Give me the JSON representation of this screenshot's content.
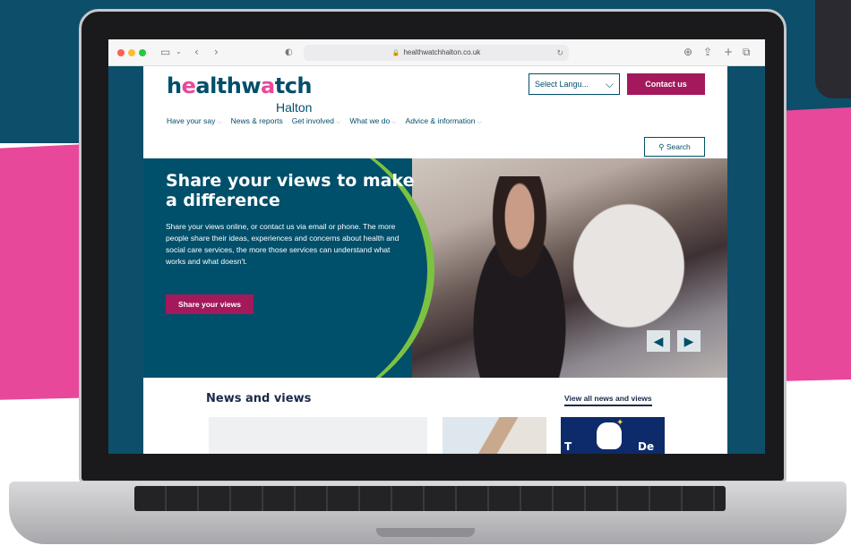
{
  "browser": {
    "url": "healthwatchhalton.co.uk"
  },
  "site": {
    "logo_main_1": "h",
    "logo_main_o": "e",
    "logo_main_2": "althw",
    "logo_main_o2": "a",
    "logo_main_3": "tch",
    "logo_sub": "Halton",
    "language_select": "Select Langu...",
    "contact_label": "Contact us",
    "search_label": "Search",
    "nav": [
      {
        "label": "Have your say",
        "has_menu": true
      },
      {
        "label": "News & reports",
        "has_menu": false
      },
      {
        "label": "Get involved",
        "has_menu": true
      },
      {
        "label": "What we do",
        "has_menu": true
      },
      {
        "label": "Advice & information",
        "has_menu": true
      }
    ]
  },
  "hero": {
    "title": "Share your views to make a difference",
    "text": "Share your views online, or contact us via email or phone. The more people share their ideas, experiences and concerns about health and social care services, the more those services can understand what works and what doesn't.",
    "button": "Share your views"
  },
  "news": {
    "title": "News and views",
    "view_all": "View all news and views",
    "card3_text_left": "T",
    "card3_text_right": "De"
  },
  "colors": {
    "brand_teal": "#004f6b",
    "brand_magenta": "#a3195b",
    "accent_green": "#7cc242",
    "background_pink": "#e8489a"
  },
  "icons": {
    "search": "magnifier-icon",
    "prev": "triangle-left-icon",
    "next": "triangle-right-icon"
  }
}
